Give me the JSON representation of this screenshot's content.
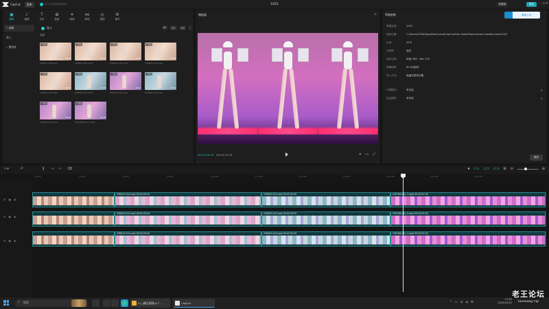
{
  "titlebar": {
    "app_name": "CapCut",
    "menu_label": "菜单",
    "autosave_text": "17:55 自动保存本地",
    "project_title": "1022",
    "shortcut_label": "快捷键",
    "export_label": "导出"
  },
  "media_toolbar": {
    "tabs": [
      {
        "label": "媒体",
        "icon": "media-icon"
      },
      {
        "label": "音频",
        "icon": "audio-icon"
      },
      {
        "label": "文本",
        "icon": "text-icon"
      },
      {
        "label": "贴纸",
        "icon": "sticker-icon"
      },
      {
        "label": "特效",
        "icon": "effects-icon"
      },
      {
        "label": "转场",
        "icon": "transition-icon"
      },
      {
        "label": "滤镜",
        "icon": "filter-icon"
      },
      {
        "label": "调节",
        "icon": "adjust-icon"
      }
    ]
  },
  "media_side": {
    "items": [
      "• 本地",
      "导入",
      "• 素材库"
    ]
  },
  "media": {
    "import_label": "导入",
    "sort_label": "排序",
    "filter_label": "全部",
    "all_label": "全部",
    "items": [
      {
        "tag": "已添加",
        "duration": "00:09",
        "name": "230611-142.mp4",
        "style": "warm"
      },
      {
        "tag": "已添加",
        "duration": "00:09",
        "name": "230611-032.mp4",
        "style": "warm"
      },
      {
        "tag": "已添加",
        "duration": "00:09",
        "name": "230611-012.mp4",
        "style": "warm"
      },
      {
        "tag": "已添加",
        "duration": "00:09",
        "name": "230607-012.mp4",
        "style": "warm"
      },
      {
        "tag": "已添加",
        "duration": "00:09",
        "name": "230617-142.mp4",
        "style": "warm"
      },
      {
        "tag": "已添加",
        "duration": "00:09",
        "name": "230617-012.mp4",
        "style": "cool"
      },
      {
        "tag": "已添加",
        "duration": "00:09",
        "name": "230613-012.mp4",
        "style": "pink"
      },
      {
        "tag": "已添加",
        "duration": "00:09",
        "name": "230625-012.mp4",
        "style": "cool"
      },
      {
        "tag": "已添加",
        "duration": "00:09",
        "name": "230613-012.mp4",
        "style": "pink"
      },
      {
        "tag": "已添加",
        "duration": "00:09",
        "name": "230708-032_2.mp4",
        "style": "pink"
      }
    ]
  },
  "player": {
    "title": "播放器",
    "current_time": "00:17:00:19",
    "total_time": "00:25:19:18"
  },
  "properties": {
    "title": "草稿参数",
    "tab_label": "剪映上手",
    "rows": [
      {
        "k": "草稿名称:",
        "v": "1022"
      },
      {
        "k": "保存位置:",
        "v": "C:/Users/20160/AppData/Local/CapCut/User Data/Projects/com.lveditor.draft/1022"
      },
      {
        "k": "比例:",
        "v": "16:9"
      },
      {
        "k": "分辨率:",
        "v": "适应"
      },
      {
        "k": "色彩空间:",
        "v": "标准 SDR - Rec.709"
      },
      {
        "k": "草稿帧率:",
        "v": "60.00帧/秒"
      },
      {
        "k": "导入方式:",
        "v": "保留在原有位置"
      },
      {
        "k": "代理模式:",
        "v": "未开启"
      },
      {
        "k": "自由图层:",
        "v": "未开启"
      }
    ],
    "modify_label": "修改"
  },
  "timeline": {
    "ruler_ticks": [
      "00:00",
      "15:00",
      "30:00",
      "45:00",
      "1:00:00",
      "1:15:00",
      "1:30:00",
      "1:45:00",
      "2:00:00",
      "2:15:00",
      "2:30:00"
    ],
    "tracks": [
      {
        "clips": [
          {
            "label": "",
            "w": 120,
            "style": "warm"
          },
          {
            "label": "230613-012.mp4 00:02:20:34",
            "w": 214,
            "style": "mix"
          },
          {
            "label": "230625-012.mp4 00:02:55:25",
            "w": 188,
            "style": "blue"
          },
          {
            "label": "230708-032_2.mp4 00:03:57:45",
            "w": 226,
            "style": "magenta"
          }
        ]
      },
      {
        "clips": [
          {
            "label": "",
            "w": 120,
            "style": "warm"
          },
          {
            "label": "230613-012.mp4 00:02:20:34",
            "w": 214,
            "style": "mix"
          },
          {
            "label": "230625-012.mp4 00:02:55:25",
            "w": 188,
            "style": "blue"
          },
          {
            "label": "230708-032_2.mp4 00:03:57:45",
            "w": 226,
            "style": "magenta"
          }
        ]
      },
      {
        "clips": [
          {
            "label": "",
            "w": 120,
            "style": "warm"
          },
          {
            "label": "230613-012.mp4 00:02:20:34",
            "w": 214,
            "style": "mix"
          },
          {
            "label": "230625-012.mp4 00:02:55:25",
            "w": 188,
            "style": "blue"
          },
          {
            "label": "230708-032_2.mp4 00:03:57:45",
            "w": 226,
            "style": "magenta"
          }
        ]
      }
    ]
  },
  "taskbar": {
    "search_label": "搜索",
    "tasks": [
      "E:\\_\\精品视频\\4.7...",
      "CapCut"
    ],
    "time": "17:55",
    "date": "2023/10/22"
  },
  "watermark": {
    "line1": "老王论坛",
    "line2": "laowang.vip"
  },
  "colors": {
    "accent": "#2fc6cf",
    "export": "#1fa6b3"
  }
}
